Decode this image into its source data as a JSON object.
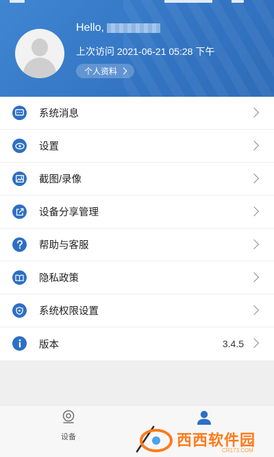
{
  "header": {
    "hello": "Hello,",
    "last_visit": "上次访问 2021-06-21 05:28 下午",
    "profile_button": "个人资料"
  },
  "menu": {
    "items": [
      {
        "label": "系统消息",
        "icon": "message-icon",
        "value": ""
      },
      {
        "label": "设置",
        "icon": "eye-settings-icon",
        "value": ""
      },
      {
        "label": "截图/录像",
        "icon": "image-icon",
        "value": ""
      },
      {
        "label": "设备分享管理",
        "icon": "share-icon",
        "value": ""
      },
      {
        "label": "帮助与客服",
        "icon": "help-icon",
        "value": ""
      },
      {
        "label": "隐私政策",
        "icon": "book-icon",
        "value": ""
      },
      {
        "label": "系统权限设置",
        "icon": "shield-icon",
        "value": ""
      },
      {
        "label": "版本",
        "icon": "info-icon",
        "value": "3.4.5"
      }
    ]
  },
  "tabbar": {
    "tabs": [
      {
        "label": "设备",
        "icon": "camera-icon",
        "active": false
      },
      {
        "label": "",
        "icon": "user-icon",
        "active": true
      }
    ]
  },
  "watermark": {
    "brand": "西西软件园",
    "site": "CR173.COM"
  },
  "colors": {
    "header_blue": "#3374c2",
    "icon_blue": "#2d6fc4",
    "watermark_orange": "#ff7a1a"
  }
}
